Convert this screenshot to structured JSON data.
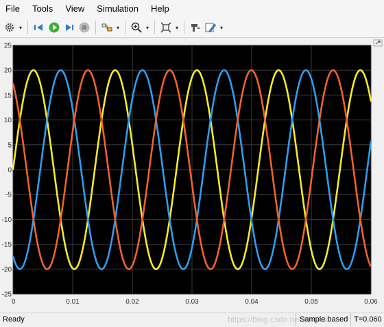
{
  "menu": {
    "items": [
      {
        "label": "File"
      },
      {
        "label": "Tools"
      },
      {
        "label": "View"
      },
      {
        "label": "Simulation"
      },
      {
        "label": "Help"
      }
    ]
  },
  "toolbar": {
    "buttons": [
      {
        "icon": "gear-icon",
        "dropdown": true
      },
      {
        "icon": "step-back-icon"
      },
      {
        "icon": "run-icon"
      },
      {
        "icon": "step-forward-icon"
      },
      {
        "icon": "stop-icon",
        "dropdown": false
      },
      {
        "icon": "highlight-model-icon",
        "dropdown": true
      },
      {
        "icon": "zoom-icon",
        "dropdown": true
      },
      {
        "icon": "fit-view-icon",
        "dropdown": true
      },
      {
        "icon": "cursor-measure-icon"
      },
      {
        "icon": "style-edit-icon",
        "dropdown": true
      }
    ]
  },
  "status": {
    "text": "Ready",
    "mode": "Sample based",
    "time": "T=0.060",
    "watermark": "https://blog.csdn.net/lortaak"
  },
  "colors": {
    "plot_bg": "#000000",
    "grid": "#3c3c3c",
    "series_yellow": "#f5ea2a",
    "series_blue": "#2b9ef0",
    "series_orange": "#f0622a",
    "tick_text": "#333333"
  },
  "chart_data": {
    "type": "line",
    "title": "",
    "xlabel": "",
    "ylabel": "",
    "xlim": [
      0,
      0.06
    ],
    "ylim": [
      -25,
      25
    ],
    "xticks": [
      0,
      0.01,
      0.02,
      0.03,
      0.04,
      0.05,
      0.06
    ],
    "xtick_labels": [
      "0",
      "0.01",
      "0.02",
      "0.03",
      "0.04",
      "0.05",
      "0.06"
    ],
    "yticks": [
      -25,
      -20,
      -15,
      -10,
      -5,
      0,
      5,
      10,
      15,
      20,
      25
    ],
    "ytick_labels": [
      "-25",
      "-20",
      "-15",
      "-10",
      "-5",
      "0",
      "5",
      "10",
      "15",
      "20",
      "25"
    ],
    "grid": true,
    "series": [
      {
        "color": "#f5ea2a",
        "amplitude": 20,
        "frequency_hz": 73,
        "phase_deg": 0
      },
      {
        "color": "#2b9ef0",
        "amplitude": 20,
        "frequency_hz": 73,
        "phase_deg": -120
      },
      {
        "color": "#f0622a",
        "amplitude": 20,
        "frequency_hz": 73,
        "phase_deg": 120
      }
    ]
  }
}
